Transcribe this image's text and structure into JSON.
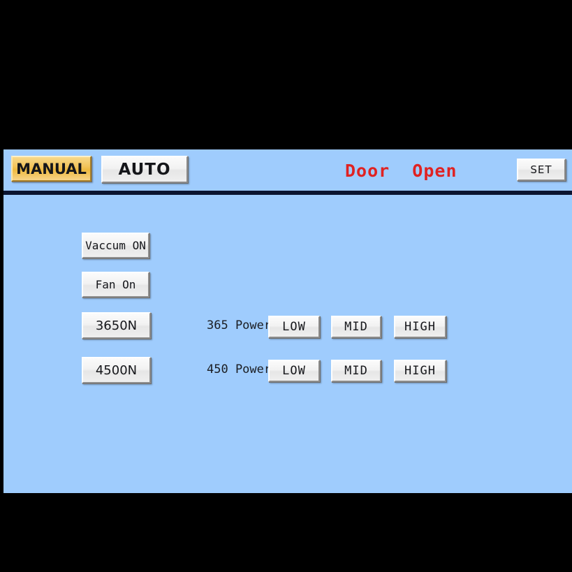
{
  "header": {
    "mode_buttons": [
      {
        "label": "MANUAL",
        "selected": true
      },
      {
        "label": "AUTO",
        "selected": false
      }
    ],
    "status": "Door  Open",
    "status_color": "#e02222",
    "set_button": "SET"
  },
  "main": {
    "device_buttons": [
      {
        "label": "Vaccum ON"
      },
      {
        "label": "Fan On"
      }
    ],
    "lamp_buttons": [
      {
        "label": "3650N"
      },
      {
        "label": "4500N"
      }
    ],
    "power_rows": [
      {
        "label": "365 Power",
        "levels": [
          {
            "label": "LOW"
          },
          {
            "label": "MID"
          },
          {
            "label": "HIGH"
          }
        ]
      },
      {
        "label": "450 Power",
        "levels": [
          {
            "label": "LOW"
          },
          {
            "label": "MID"
          },
          {
            "label": "HIGH"
          }
        ]
      }
    ]
  },
  "theme": {
    "panel_background": "#9fccfd",
    "frame_background": "#000000",
    "separator": "#0b1430",
    "selected_button": "#eeb93f",
    "button_face": "#efefef"
  }
}
